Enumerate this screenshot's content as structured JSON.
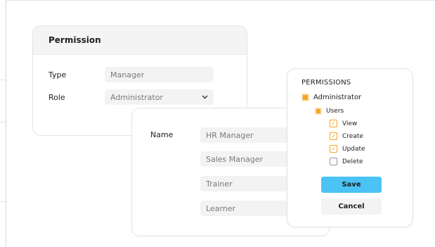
{
  "permission_card": {
    "title": "Permission",
    "type_label": "Type",
    "type_value": "Manager",
    "role_label": "Role",
    "role_value": "Administrator",
    "role_icon": "chevron-down-icon"
  },
  "name_card": {
    "label": "Name",
    "items": [
      "HR Manager",
      "Sales Manager",
      "Trainer",
      "Learner"
    ]
  },
  "permissions_panel": {
    "title": "PERMISSIONS",
    "role": "Administrator",
    "group": "Users",
    "actions": [
      {
        "label": "View",
        "checked": true
      },
      {
        "label": "Create",
        "checked": true
      },
      {
        "label": "Update",
        "checked": true
      },
      {
        "label": "Delete",
        "checked": false
      }
    ],
    "save_label": "Save",
    "cancel_label": "Cancel"
  },
  "colors": {
    "accent": "#f5a623",
    "save_button": "#4cc3f5",
    "field_bg": "#f3f3f3"
  }
}
